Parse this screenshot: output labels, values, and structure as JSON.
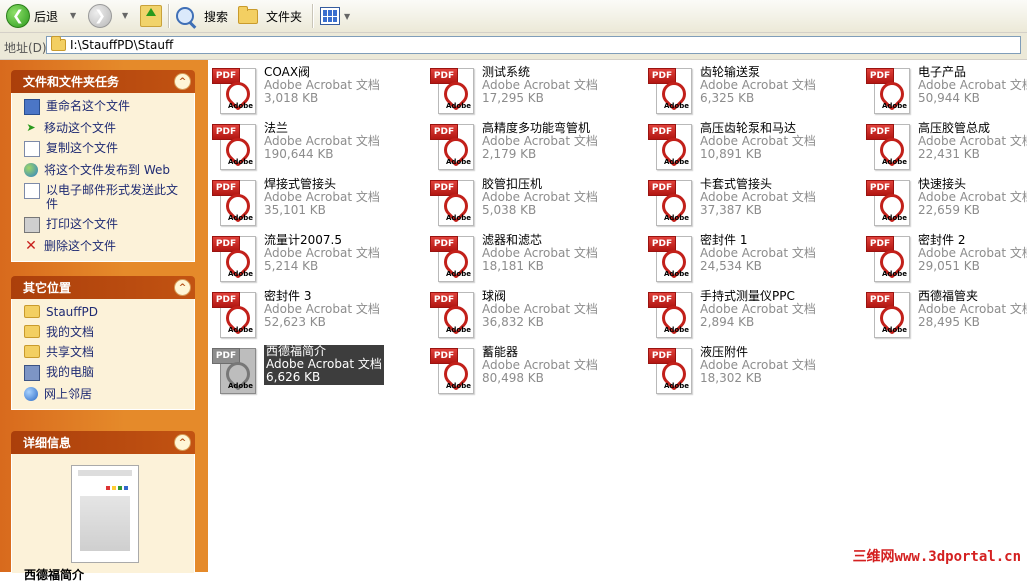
{
  "toolbar": {
    "back_label": "后退",
    "search_label": "搜索",
    "folders_label": "文件夹"
  },
  "address": {
    "label": "地址(D)",
    "path": "I:\\StauffPD\\Stauff"
  },
  "file_tasks": {
    "title": "文件和文件夹任务",
    "items": [
      {
        "label": "重命名这个文件",
        "icon": "rename-icon"
      },
      {
        "label": "移动这个文件",
        "icon": "move-icon"
      },
      {
        "label": "复制这个文件",
        "icon": "copy-icon"
      },
      {
        "label": "将这个文件发布到 Web",
        "icon": "publish-web-icon"
      },
      {
        "label": "以电子邮件形式发送此文件",
        "icon": "email-icon"
      },
      {
        "label": "打印这个文件",
        "icon": "print-icon"
      },
      {
        "label": "删除这个文件",
        "icon": "delete-icon"
      }
    ]
  },
  "other_places": {
    "title": "其它位置",
    "items": [
      {
        "label": "StauffPD",
        "icon": "folder-icon"
      },
      {
        "label": "我的文档",
        "icon": "folder-icon"
      },
      {
        "label": "共享文档",
        "icon": "folder-icon"
      },
      {
        "label": "我的电脑",
        "icon": "computer-icon"
      },
      {
        "label": "网上邻居",
        "icon": "network-icon"
      }
    ]
  },
  "details": {
    "title": "详细信息",
    "name": "西德福简介"
  },
  "files": [
    {
      "name": "COAX阀",
      "type": "Adobe Acrobat 文档",
      "size": "3,018 KB"
    },
    {
      "name": "测试系统",
      "type": "Adobe Acrobat 文档",
      "size": "17,295 KB"
    },
    {
      "name": "齿轮输送泵",
      "type": "Adobe Acrobat 文档",
      "size": "6,325 KB"
    },
    {
      "name": "电子产品",
      "type": "Adobe Acrobat 文档",
      "size": "50,944 KB"
    },
    {
      "name": "法兰",
      "type": "Adobe Acrobat 文档",
      "size": "190,644 KB"
    },
    {
      "name": "高精度多功能弯管机",
      "type": "Adobe Acrobat 文档",
      "size": "2,179 KB"
    },
    {
      "name": "高压齿轮泵和马达",
      "type": "Adobe Acrobat 文档",
      "size": "10,891 KB"
    },
    {
      "name": "高压胶管总成",
      "type": "Adobe Acrobat 文档",
      "size": "22,431 KB"
    },
    {
      "name": "焊接式管接头",
      "type": "Adobe Acrobat 文档",
      "size": "35,101 KB"
    },
    {
      "name": "胶管扣压机",
      "type": "Adobe Acrobat 文档",
      "size": "5,038 KB"
    },
    {
      "name": "卡套式管接头",
      "type": "Adobe Acrobat 文档",
      "size": "37,387 KB"
    },
    {
      "name": "快速接头",
      "type": "Adobe Acrobat 文档",
      "size": "22,659 KB"
    },
    {
      "name": "流量计2007.5",
      "type": "Adobe Acrobat 文档",
      "size": "5,214 KB"
    },
    {
      "name": "滤器和滤芯",
      "type": "Adobe Acrobat 文档",
      "size": "18,181 KB"
    },
    {
      "name": "密封件 1",
      "type": "Adobe Acrobat 文档",
      "size": "24,534 KB"
    },
    {
      "name": "密封件 2",
      "type": "Adobe Acrobat 文档",
      "size": "29,051 KB"
    },
    {
      "name": "密封件 3",
      "type": "Adobe Acrobat 文档",
      "size": "52,623 KB"
    },
    {
      "name": "球阀",
      "type": "Adobe Acrobat 文档",
      "size": "36,832 KB"
    },
    {
      "name": "手持式测量仪PPC",
      "type": "Adobe Acrobat 文档",
      "size": "2,894 KB"
    },
    {
      "name": "西德福管夹",
      "type": "Adobe Acrobat 文档",
      "size": "28,495 KB"
    },
    {
      "name": "西德福简介",
      "type": "Adobe Acrobat 文档",
      "size": "6,626 KB",
      "selected": true
    },
    {
      "name": "蓄能器",
      "type": "Adobe Acrobat 文档",
      "size": "80,498 KB"
    },
    {
      "name": "液压附件",
      "type": "Adobe Acrobat 文档",
      "size": "18,302 KB"
    }
  ],
  "watermark": "三维网www.3dportal.cn",
  "colors": {
    "task_header": "#ab3f0b",
    "pane_bg": "#e58a2a",
    "selection": "#3d3d3d",
    "pdf_red": "#c2201a"
  }
}
